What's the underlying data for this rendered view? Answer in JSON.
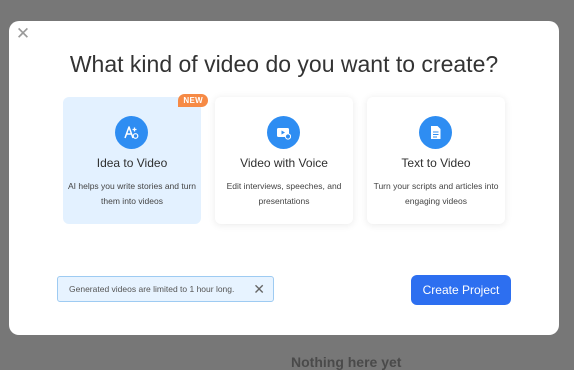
{
  "background": {
    "partial_text": "Nothing here yet"
  },
  "modal": {
    "close_glyph": "✕",
    "title": "What kind of video do you want to create?",
    "cards": [
      {
        "title": "Idea to Video",
        "description": "AI helps you write stories and turn them into videos",
        "badge": "NEW",
        "selected": true,
        "icon": "ai-sparkle-icon"
      },
      {
        "title": "Video with Voice",
        "description": "Edit interviews, speeches, and presentations",
        "selected": false,
        "icon": "video-voice-icon"
      },
      {
        "title": "Text to Video",
        "description": "Turn your scripts and articles into engaging videos",
        "selected": false,
        "icon": "document-icon"
      }
    ],
    "notice": {
      "text": "Generated videos are limited to 1 hour long.",
      "close_glyph": "✕"
    },
    "create_button_label": "Create Project"
  },
  "colors": {
    "accent": "#2e8df2",
    "primary_button": "#2d6ff0",
    "badge": "#f68a45",
    "selected_card_bg": "#e3f1ff",
    "overlay": "#777777"
  }
}
